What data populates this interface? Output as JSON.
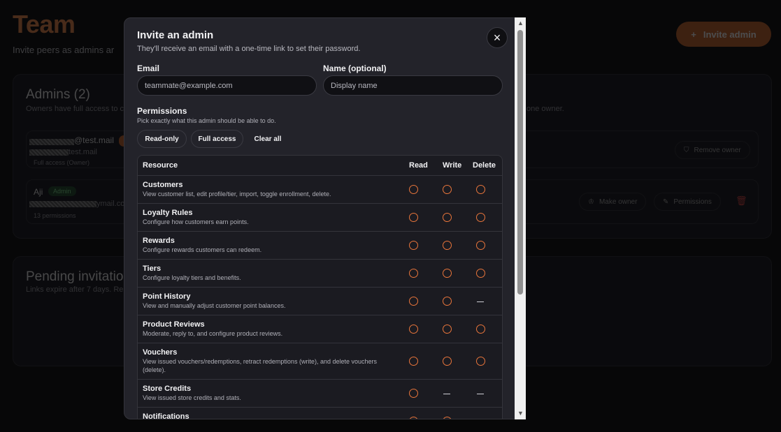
{
  "background": {
    "title": "Team",
    "subtitle": "Invite peers as admins ar",
    "invite_button": {
      "icon": "+",
      "label": "Invite admin"
    },
    "admins_card": {
      "title": "Admins (2)",
      "desc_left": "Owners have full access to c",
      "desc_right": "one owner.",
      "rows": [
        {
          "email_tail_1": "@test.mail",
          "email_tail_2": "test.mail",
          "meta": "Full access (Owner)",
          "action": {
            "icon": "shield-icon",
            "label": "Remove owner"
          }
        },
        {
          "name": "Aji",
          "badge": "Admin",
          "email_tail": "ymail.co",
          "meta": "13 permissions",
          "actions": [
            {
              "icon": "crown-icon",
              "label": "Make owner"
            },
            {
              "icon": "pencil-icon",
              "label": "Permissions"
            }
          ]
        }
      ]
    },
    "pending_card": {
      "title": "Pending invitatio",
      "desc": "Links expire after 7 days. Re"
    }
  },
  "modal": {
    "title": "Invite an admin",
    "subtitle": "They'll receive an email with a one-time link to set their password.",
    "close_icon": "×",
    "email": {
      "label": "Email",
      "value": "",
      "placeholder": "teammate@example.com"
    },
    "name": {
      "label": "Name (optional)",
      "value": "",
      "placeholder": "Display name"
    },
    "permissions": {
      "title": "Permissions",
      "subtitle": "Pick exactly what this admin should be able to do.",
      "presets": [
        "Read-only",
        "Full access",
        "Clear all"
      ],
      "columns": [
        "Resource",
        "Read",
        "Write",
        "Delete"
      ],
      "rows": [
        {
          "name": "Customers",
          "desc": "View customer list, edit profile/tier, import, toggle enrollment, delete.",
          "read": "radio",
          "write": "radio",
          "delete": "radio"
        },
        {
          "name": "Loyalty Rules",
          "desc": "Configure how customers earn points.",
          "read": "radio",
          "write": "radio",
          "delete": "radio"
        },
        {
          "name": "Rewards",
          "desc": "Configure rewards customers can redeem.",
          "read": "radio",
          "write": "radio",
          "delete": "radio"
        },
        {
          "name": "Tiers",
          "desc": "Configure loyalty tiers and benefits.",
          "read": "radio",
          "write": "radio",
          "delete": "radio"
        },
        {
          "name": "Point History",
          "desc": "View and manually adjust customer point balances.",
          "read": "radio",
          "write": "radio",
          "delete": "—"
        },
        {
          "name": "Product Reviews",
          "desc": "Moderate, reply to, and configure product reviews.",
          "read": "radio",
          "write": "radio",
          "delete": "radio"
        },
        {
          "name": "Vouchers",
          "desc": "View issued vouchers/redemptions, retract redemptions (write), and delete vouchers (delete).",
          "read": "radio",
          "write": "radio",
          "delete": "radio"
        },
        {
          "name": "Store Credits",
          "desc": "View issued store credits and stats.",
          "read": "radio",
          "write": "—",
          "delete": "—"
        },
        {
          "name": "Notifications",
          "desc": "",
          "read": "radio",
          "write": "radio",
          "delete": ""
        }
      ]
    }
  },
  "colors": {
    "accent": "#e8753b",
    "modal_bg": "#23232a",
    "page_bg": "#070708"
  }
}
